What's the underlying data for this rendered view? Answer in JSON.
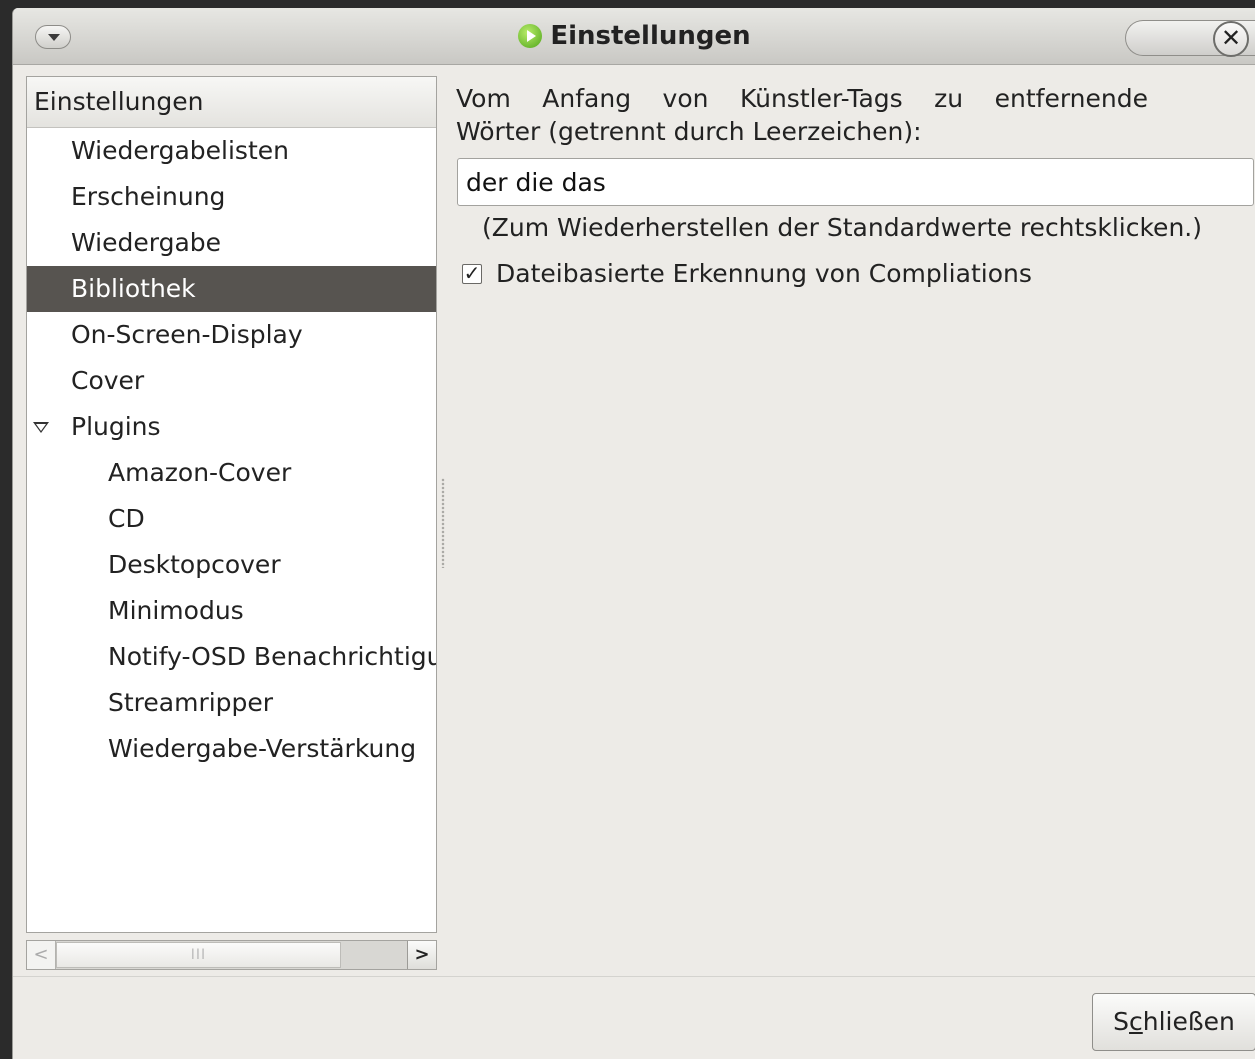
{
  "window": {
    "title": "Einstellungen",
    "close_glyph": "✕"
  },
  "sidebar": {
    "header": "Einstellungen",
    "items": [
      {
        "label": "Wiedergabelisten"
      },
      {
        "label": "Erscheinung"
      },
      {
        "label": "Wiedergabe"
      },
      {
        "label": "Bibliothek",
        "selected": true
      },
      {
        "label": "On-Screen-Display"
      },
      {
        "label": "Cover"
      },
      {
        "label": "Plugins",
        "expanded": true
      }
    ],
    "plugins": [
      {
        "label": "Amazon-Cover"
      },
      {
        "label": "CD"
      },
      {
        "label": "Desktopcover"
      },
      {
        "label": "Minimodus"
      },
      {
        "label": "Notify-OSD Benachrichtigungen"
      },
      {
        "label": "Streamripper"
      },
      {
        "label": "Wiedergabe-Verstärkung"
      }
    ],
    "scrollbar": {
      "left_arrow": "<",
      "right_arrow": ">",
      "grip": "III"
    }
  },
  "library": {
    "description_words": [
      "Vom",
      "Anfang",
      "von",
      "Künstler-Tags",
      "zu",
      "entfernende"
    ],
    "description_line2": "Wörter (getrennt durch Leerzeichen):",
    "words_value": "der die das",
    "hint": "(Zum Wiederherstellen der Standardwerte rechtsklicken.)",
    "compilation_check": {
      "label": "Dateibasierte Erkennung von Compliations",
      "checked": true,
      "mark": "✓"
    }
  },
  "footer": {
    "close_label_pre": "S",
    "close_label_mnemonic": "c",
    "close_label_post": "hließen"
  },
  "colors": {
    "selection": "#575450",
    "background": "#edebe7",
    "app_icon": "#4fa51a"
  }
}
